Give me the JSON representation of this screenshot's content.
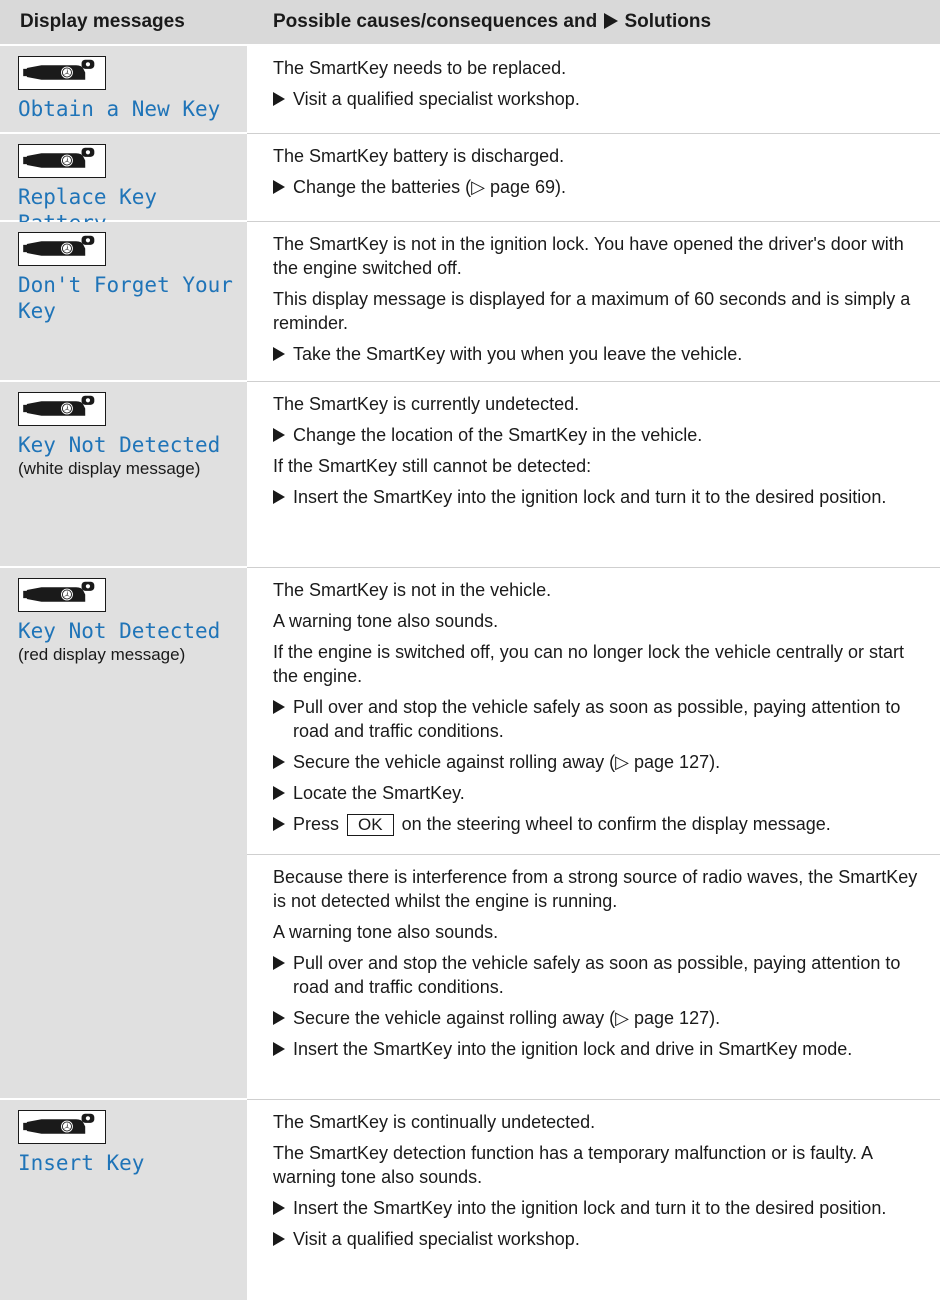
{
  "header": {
    "col1": "Display messages",
    "col2_prefix": "Possible causes/consequences and",
    "col2_suffix": "Solutions"
  },
  "icons": {
    "key": "smartkey-icon",
    "bullet": "triangle-bullet-icon"
  },
  "colors": {
    "message_blue": "#1f74b8",
    "header_gray": "#d9d9d9",
    "left_gray": "#e0e0e0"
  },
  "rows": {
    "r1": {
      "message": "Obtain a New Key",
      "p1": "The SmartKey needs to be replaced.",
      "b1": "Visit a qualified specialist workshop."
    },
    "r2": {
      "message": "Replace Key Battery",
      "p1": "The SmartKey battery is discharged.",
      "b1": "Change the batteries (▷ page 69)."
    },
    "r3": {
      "message": "Don't Forget Your Key",
      "p1": "The SmartKey is not in the ignition lock. You have opened the driver's door with the engine switched off.",
      "p2": "This display message is displayed for a maximum of 60 seconds and is simply a reminder.",
      "b1": "Take the SmartKey with you when you leave the vehicle."
    },
    "r4": {
      "message": "Key Not Detected",
      "note": "(white display message)",
      "p1": "The SmartKey is currently undetected.",
      "b1": "Change the location of the SmartKey in the vehicle.",
      "p2": "If the SmartKey still cannot be detected:",
      "b2": "Insert the SmartKey into the ignition lock and turn it to the desired position."
    },
    "r5": {
      "message": "Key Not Detected",
      "note": "(red display message)",
      "a_p1": "The SmartKey is not in the vehicle.",
      "a_p2": "A warning tone also sounds.",
      "a_p3": "If the engine is switched off, you can no longer lock the vehicle centrally or start the engine.",
      "a_b1": "Pull over and stop the vehicle safely as soon as possible, paying attention to road and traffic conditions.",
      "a_b2": "Secure the vehicle against rolling away (▷ page 127).",
      "a_b3": "Locate the SmartKey.",
      "a_b4_pre": "Press",
      "a_b4_btn": "OK",
      "a_b4_post": "on the steering wheel to confirm the display message.",
      "b_p1": "Because there is interference from a strong source of radio waves, the SmartKey is not detected whilst the engine is running.",
      "b_p2": "A warning tone also sounds.",
      "b_b1": "Pull over and stop the vehicle safely as soon as possible, paying attention to road and traffic conditions.",
      "b_b2": "Secure the vehicle against rolling away (▷ page 127).",
      "b_b3": "Insert the SmartKey into the ignition lock and drive in SmartKey mode."
    },
    "r6": {
      "message": "Insert Key",
      "p1": "The SmartKey is continually undetected.",
      "p2": "The SmartKey detection function has a temporary malfunction or is faulty. A warning tone also sounds.",
      "b1": "Insert the SmartKey into the ignition lock and turn it to the desired position.",
      "b2": "Visit a qualified specialist workshop."
    }
  }
}
